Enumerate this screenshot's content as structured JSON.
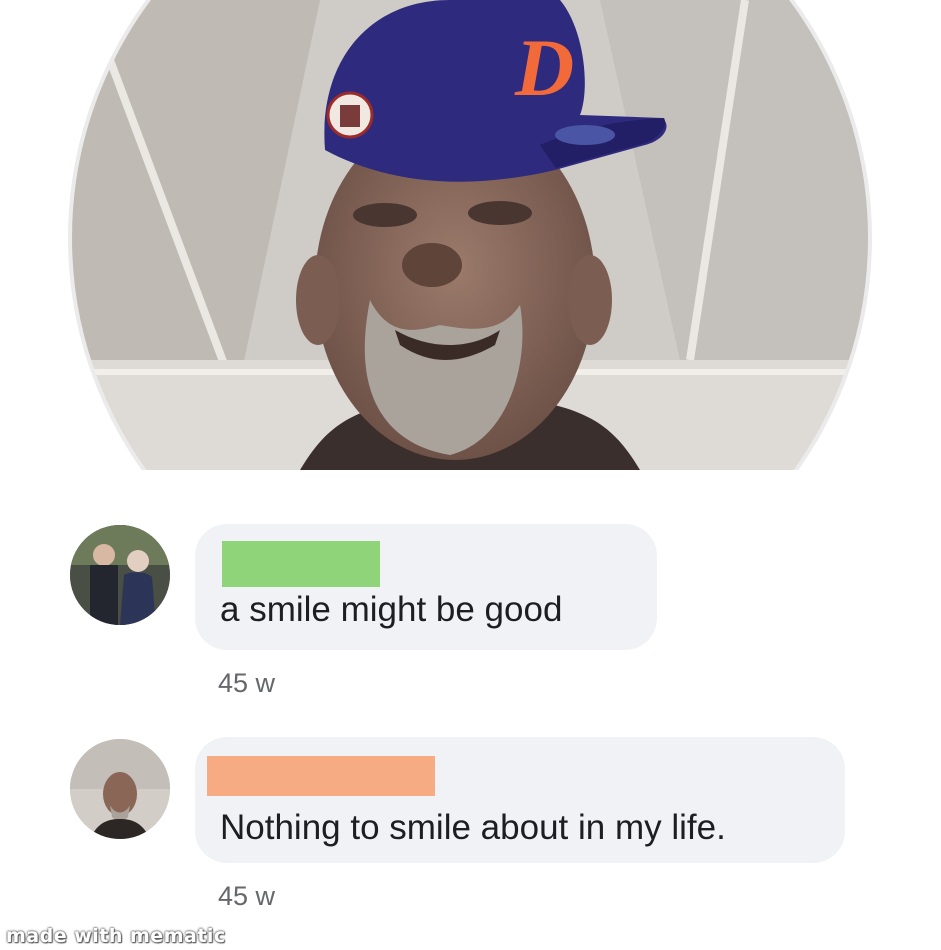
{
  "profile_photo": {
    "description_icon": "profile-photo",
    "cap_letter": "D",
    "colors": {
      "cap": "#2e2a7d",
      "cap_logo": "#f26a3a",
      "ring": "#e9e9e9"
    }
  },
  "comments": [
    {
      "avatar_icon": "couple-avatar",
      "name_redaction_color": "#90d47a",
      "text": "a smile might be good",
      "time": "45 w"
    },
    {
      "avatar_icon": "man-avatar",
      "name_redaction_color": "#f6ab82",
      "text": "Nothing to smile about in my life.",
      "time": "45 w"
    }
  ],
  "watermark": "made with mematic"
}
